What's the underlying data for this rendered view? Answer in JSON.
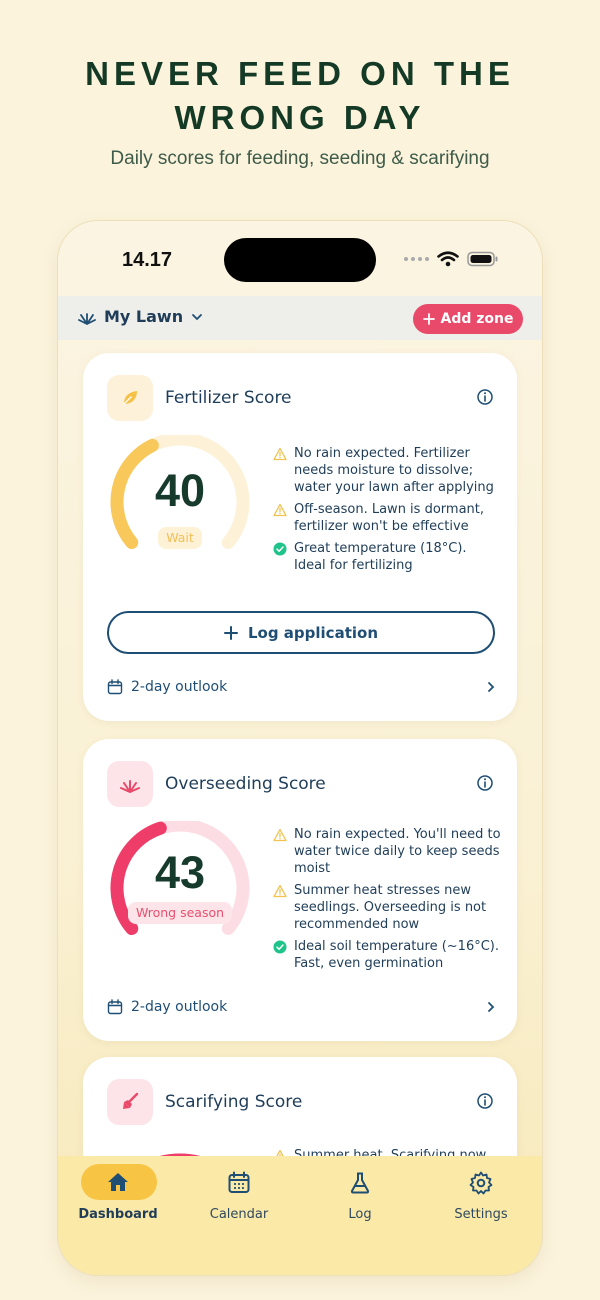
{
  "promo": {
    "headline_line1": "NEVER FEED ON THE",
    "headline_line2": "WRONG DAY",
    "subheadline": "Daily scores for feeding, seeding & scarifying"
  },
  "status_bar": {
    "time": "14.17"
  },
  "zone_bar": {
    "zone_name": "My Lawn",
    "add_zone_label": "Add zone",
    "add_zone_icon": "plus-icon"
  },
  "colors": {
    "brand_green": "#143a26",
    "navy_text": "#1f3d58",
    "accent_pink": "#e94a6a",
    "score_yellow": "#f8c85a",
    "score_red": "#ee3d68",
    "ok_green": "#1fc48a",
    "nav_background": "#fbe9a8"
  },
  "cards": [
    {
      "title": "Fertilizer Score",
      "icon": "leaf-icon",
      "score": "40",
      "score_value": 40,
      "status": "Wait",
      "tips": [
        {
          "type": "warning",
          "text": "No rain expected. Fertilizer needs moisture to dissolve; water your lawn after applying"
        },
        {
          "type": "warning",
          "text": "Off-season. Lawn is dormant, fertilizer won't be effective"
        },
        {
          "type": "ok",
          "text": "Great temperature (18°C). Ideal for fertilizing"
        }
      ],
      "action_label": "Log application",
      "outlook_label": "2-day outlook"
    },
    {
      "title": "Overseeding Score",
      "icon": "sprout-icon",
      "score": "43",
      "score_value": 43,
      "status": "Wrong season",
      "tips": [
        {
          "type": "warning",
          "text": "No rain expected. You'll need to water twice daily to keep seeds moist"
        },
        {
          "type": "warning",
          "text": "Summer heat stresses new seedlings. Overseeding is not recommended now"
        },
        {
          "type": "ok",
          "text": "Ideal soil temperature (~16°C). Fast, even germination"
        }
      ],
      "outlook_label": "2-day outlook"
    },
    {
      "title": "Scarifying Score",
      "icon": "rake-icon",
      "tips": [
        {
          "type": "warning",
          "text": "Summer heat. Scarifying now"
        }
      ]
    }
  ],
  "nav": {
    "items": [
      {
        "label": "Dashboard",
        "icon": "home-icon",
        "active": true
      },
      {
        "label": "Calendar",
        "icon": "calendar-icon",
        "active": false
      },
      {
        "label": "Log",
        "icon": "flask-icon",
        "active": false
      },
      {
        "label": "Settings",
        "icon": "gear-icon",
        "active": false
      }
    ]
  }
}
